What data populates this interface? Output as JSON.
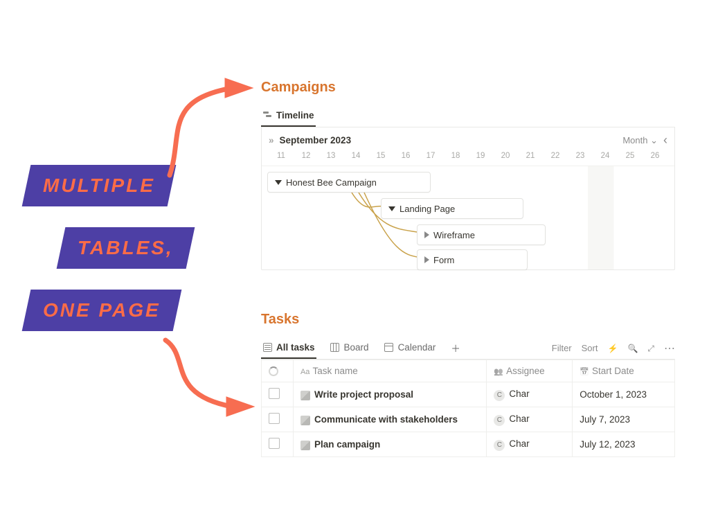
{
  "annotation": {
    "line1": "MULTIPLE",
    "line2": "TABLES,",
    "line3": "ONE PAGE"
  },
  "campaigns": {
    "title": "Campaigns",
    "tab_timeline": "Timeline",
    "month_label": "September 2023",
    "granularity": "Month",
    "dates": [
      "11",
      "12",
      "13",
      "14",
      "15",
      "16",
      "17",
      "18",
      "19",
      "20",
      "21",
      "22",
      "23",
      "24",
      "25",
      "26"
    ],
    "bars": {
      "parent": "Honest Bee Campaign",
      "group": "Landing Page",
      "child1": "Wireframe",
      "child2": "Form"
    }
  },
  "tasks": {
    "title": "Tasks",
    "tabs": {
      "all": "All tasks",
      "board": "Board",
      "calendar": "Calendar"
    },
    "toolbar": {
      "filter": "Filter",
      "sort": "Sort"
    },
    "columns": {
      "task": "Task name",
      "assignee": "Assignee",
      "start": "Start Date"
    },
    "rows": [
      {
        "name": "Write project proposal",
        "assignee": "Char",
        "date": "October 1, 2023"
      },
      {
        "name": "Communicate with stakeholders",
        "assignee": "Char",
        "date": "July 7, 2023"
      },
      {
        "name": "Plan campaign",
        "assignee": "Char",
        "date": "July 12, 2023"
      }
    ]
  }
}
